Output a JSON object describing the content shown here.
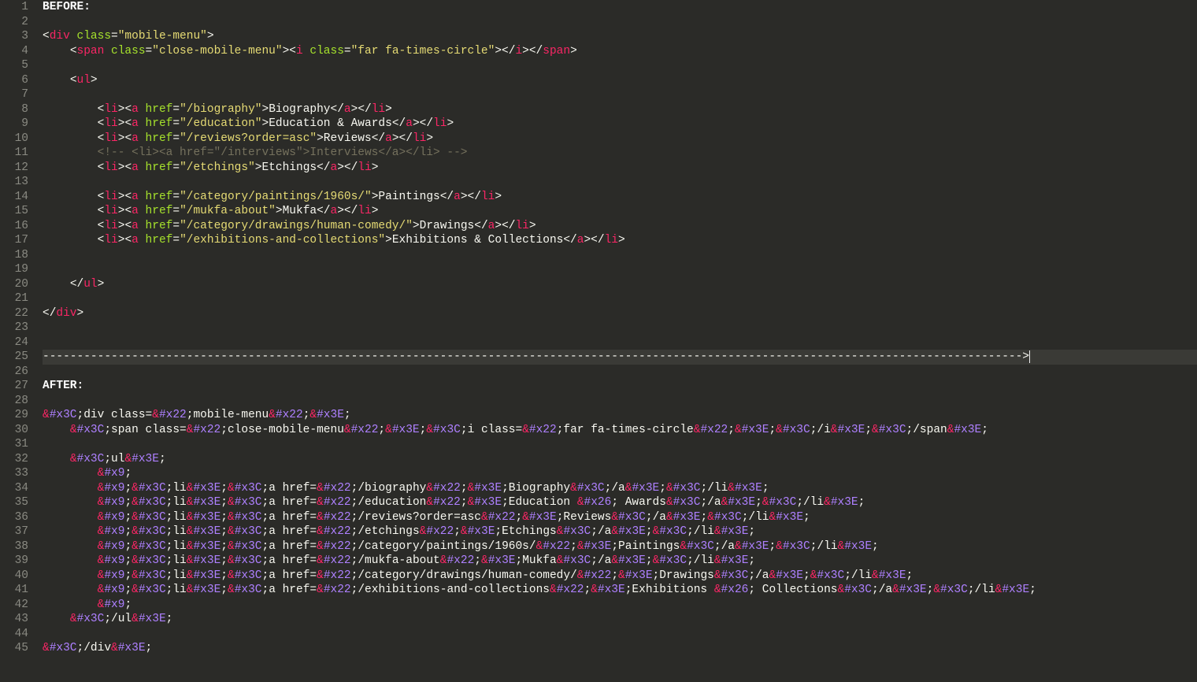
{
  "gutter": {
    "start": 1,
    "end": 45
  },
  "before_label": "BEFORE:",
  "after_label": "AFTER:",
  "separator_len": 143,
  "active_line": 25,
  "before": {
    "div_open": {
      "tag": "div",
      "attrs": [
        {
          "n": "class",
          "v": "\"mobile-menu\""
        }
      ]
    },
    "span_open": {
      "tag": "span",
      "attrs": [
        {
          "n": "class",
          "v": "\"close-mobile-menu\""
        }
      ]
    },
    "i_open": {
      "tag": "i",
      "attrs": [
        {
          "n": "class",
          "v": "\"far fa-times-circle\""
        }
      ]
    },
    "i_close": "i",
    "span_close": "span",
    "ul_open": {
      "tag": "ul",
      "attrs": []
    },
    "ul_close": "ul",
    "div_close": "div",
    "items": [
      {
        "href": "\"/biography\"",
        "text": "Biography"
      },
      {
        "href": "\"/education\"",
        "text": "Education & Awards"
      },
      {
        "href": "\"/reviews?order=asc\"",
        "text": "Reviews"
      }
    ],
    "comment": "<!-- <li><a href=\"/interviews\">Interviews</a></li> -->",
    "etchings": {
      "href": "\"/etchings\"",
      "text": "Etchings"
    },
    "items2": [
      {
        "href": "\"/category/paintings/1960s/\"",
        "text": "Paintings"
      },
      {
        "href": "\"/mukfa-about\"",
        "text": "Mukfa"
      },
      {
        "href": "\"/category/drawings/human-comedy/\"",
        "text": "Drawings"
      },
      {
        "href": "\"/exhibitions-and-collections\"",
        "text": "Exhibitions & Collections"
      }
    ]
  },
  "after": {
    "div_open": {
      "pre": "",
      "parts": [
        "&#x3C;",
        "div class=",
        "&#x22;",
        "mobile-menu",
        "&#x22;",
        "&#x3E;"
      ]
    },
    "span_line": {
      "pre": "    ",
      "parts": [
        "&#x3C;",
        "span class=",
        "&#x22;",
        "close-mobile-menu",
        "&#x22;",
        "&#x3E;",
        "&#x3C;",
        "i class=",
        "&#x22;",
        "far fa-times-circle",
        "&#x22;",
        "&#x3E;",
        "&#x3C;",
        "/i",
        "&#x3E;",
        "&#x3C;",
        "/span",
        "&#x3E;"
      ]
    },
    "ul_open": {
      "pre": "    ",
      "parts": [
        "&#x3C;",
        "ul",
        "&#x3E;"
      ]
    },
    "tab_only": {
      "pre": "        ",
      "parts": [
        "&#x9;"
      ]
    },
    "items": [
      {
        "pre": "        ",
        "parts": [
          "&#x9;",
          "&#x3C;",
          "li",
          "&#x3E;",
          "&#x3C;",
          "a href=",
          "&#x22;",
          "/biography",
          "&#x22;",
          "&#x3E;",
          "Biography",
          "&#x3C;",
          "/a",
          "&#x3E;",
          "&#x3C;",
          "/li",
          "&#x3E;"
        ]
      },
      {
        "pre": "        ",
        "parts": [
          "&#x9;",
          "&#x3C;",
          "li",
          "&#x3E;",
          "&#x3C;",
          "a href=",
          "&#x22;",
          "/education",
          "&#x22;",
          "&#x3E;",
          "Education ",
          "&#x26;",
          " Awards",
          "&#x3C;",
          "/a",
          "&#x3E;",
          "&#x3C;",
          "/li",
          "&#x3E;"
        ]
      },
      {
        "pre": "        ",
        "parts": [
          "&#x9;",
          "&#x3C;",
          "li",
          "&#x3E;",
          "&#x3C;",
          "a href=",
          "&#x22;",
          "/reviews?order=asc",
          "&#x22;",
          "&#x3E;",
          "Reviews",
          "&#x3C;",
          "/a",
          "&#x3E;",
          "&#x3C;",
          "/li",
          "&#x3E;"
        ]
      },
      {
        "pre": "        ",
        "parts": [
          "&#x9;",
          "&#x3C;",
          "li",
          "&#x3E;",
          "&#x3C;",
          "a href=",
          "&#x22;",
          "/etchings",
          "&#x22;",
          "&#x3E;",
          "Etchings",
          "&#x3C;",
          "/a",
          "&#x3E;",
          "&#x3C;",
          "/li",
          "&#x3E;"
        ]
      },
      {
        "pre": "        ",
        "parts": [
          "&#x9;",
          "&#x3C;",
          "li",
          "&#x3E;",
          "&#x3C;",
          "a href=",
          "&#x22;",
          "/category/paintings/1960s/",
          "&#x22;",
          "&#x3E;",
          "Paintings",
          "&#x3C;",
          "/a",
          "&#x3E;",
          "&#x3C;",
          "/li",
          "&#x3E;"
        ]
      },
      {
        "pre": "        ",
        "parts": [
          "&#x9;",
          "&#x3C;",
          "li",
          "&#x3E;",
          "&#x3C;",
          "a href=",
          "&#x22;",
          "/mukfa-about",
          "&#x22;",
          "&#x3E;",
          "Mukfa",
          "&#x3C;",
          "/a",
          "&#x3E;",
          "&#x3C;",
          "/li",
          "&#x3E;"
        ]
      },
      {
        "pre": "        ",
        "parts": [
          "&#x9;",
          "&#x3C;",
          "li",
          "&#x3E;",
          "&#x3C;",
          "a href=",
          "&#x22;",
          "/category/drawings/human-comedy/",
          "&#x22;",
          "&#x3E;",
          "Drawings",
          "&#x3C;",
          "/a",
          "&#x3E;",
          "&#x3C;",
          "/li",
          "&#x3E;"
        ]
      },
      {
        "pre": "        ",
        "parts": [
          "&#x9;",
          "&#x3C;",
          "li",
          "&#x3E;",
          "&#x3C;",
          "a href=",
          "&#x22;",
          "/exhibitions-and-collections",
          "&#x22;",
          "&#x3E;",
          "Exhibitions ",
          "&#x26;",
          " Collections",
          "&#x3C;",
          "/a",
          "&#x3E;",
          "&#x3C;",
          "/li",
          "&#x3E;"
        ]
      }
    ],
    "tab_only2": {
      "pre": "        ",
      "parts": [
        "&#x9;"
      ]
    },
    "ul_close": {
      "pre": "    ",
      "parts": [
        "&#x3C;",
        "/ul",
        "&#x3E;"
      ]
    },
    "div_close": {
      "pre": "",
      "parts": [
        "&#x3C;",
        "/div",
        "&#x3E;"
      ]
    }
  }
}
